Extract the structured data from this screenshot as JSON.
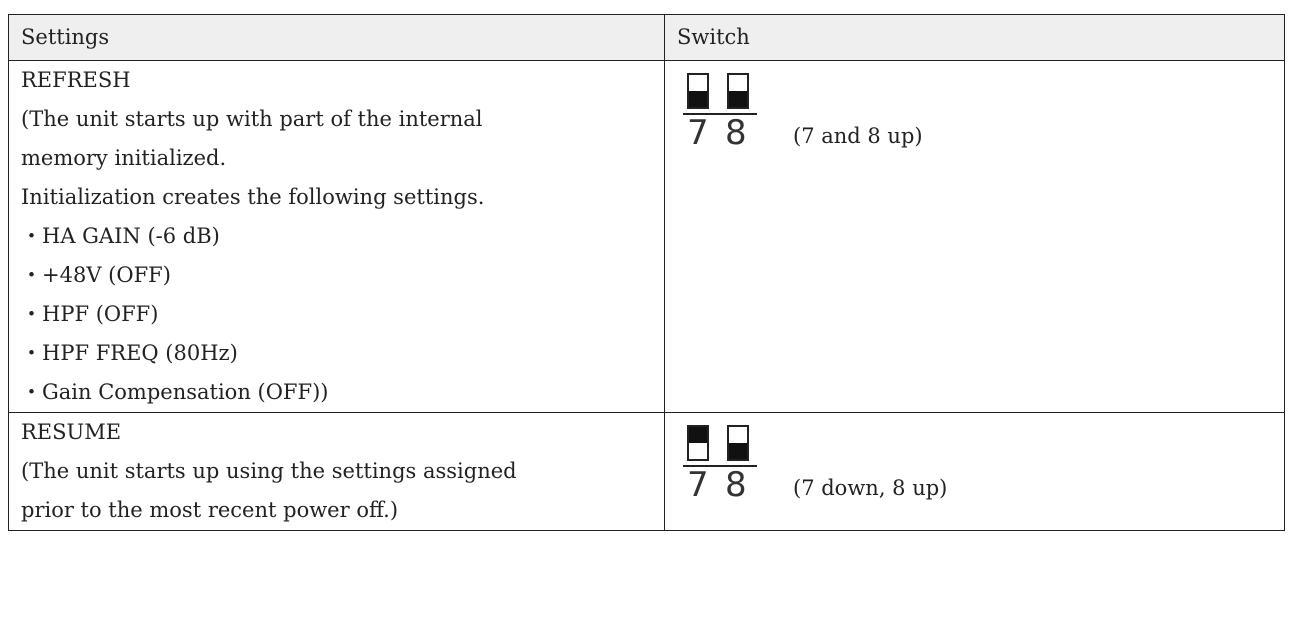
{
  "table": {
    "headers": [
      "Settings",
      "Switch"
    ],
    "rows": [
      {
        "lines": [
          "REFRESH",
          "(The unit starts up with part of the internal",
          "memory initialized.",
          "Initialization creates the following settings.",
          "・HA GAIN (-6 dB)",
          "・+48V (OFF)",
          "・HPF (OFF)",
          "・HPF FREQ (80Hz)",
          "・Gain Compensation (OFF))"
        ],
        "switch": {
          "labels": [
            "7",
            "8"
          ],
          "positions": [
            "up",
            "up"
          ],
          "description": "(7 and 8 up)"
        }
      },
      {
        "lines": [
          "RESUME",
          "(The unit starts up using the settings assigned",
          "prior to the most recent power off.)"
        ],
        "switch": {
          "labels": [
            "7",
            "8"
          ],
          "positions": [
            "down",
            "up"
          ],
          "description": "(7 down, 8 up)"
        }
      }
    ]
  },
  "colors": {
    "header_bg": "#efefef",
    "border": "#222222",
    "switch_fill": "#111111"
  }
}
